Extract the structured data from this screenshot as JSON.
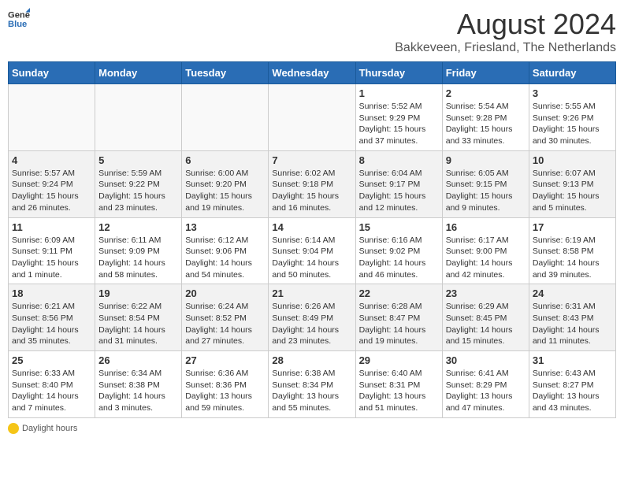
{
  "header": {
    "logo_general": "General",
    "logo_blue": "Blue",
    "title": "August 2024",
    "subtitle": "Bakkeveen, Friesland, The Netherlands"
  },
  "days_of_week": [
    "Sunday",
    "Monday",
    "Tuesday",
    "Wednesday",
    "Thursday",
    "Friday",
    "Saturday"
  ],
  "weeks": [
    [
      {
        "day": "",
        "info": ""
      },
      {
        "day": "",
        "info": ""
      },
      {
        "day": "",
        "info": ""
      },
      {
        "day": "",
        "info": ""
      },
      {
        "day": "1",
        "info": "Sunrise: 5:52 AM\nSunset: 9:29 PM\nDaylight: 15 hours\nand 37 minutes."
      },
      {
        "day": "2",
        "info": "Sunrise: 5:54 AM\nSunset: 9:28 PM\nDaylight: 15 hours\nand 33 minutes."
      },
      {
        "day": "3",
        "info": "Sunrise: 5:55 AM\nSunset: 9:26 PM\nDaylight: 15 hours\nand 30 minutes."
      }
    ],
    [
      {
        "day": "4",
        "info": "Sunrise: 5:57 AM\nSunset: 9:24 PM\nDaylight: 15 hours\nand 26 minutes."
      },
      {
        "day": "5",
        "info": "Sunrise: 5:59 AM\nSunset: 9:22 PM\nDaylight: 15 hours\nand 23 minutes."
      },
      {
        "day": "6",
        "info": "Sunrise: 6:00 AM\nSunset: 9:20 PM\nDaylight: 15 hours\nand 19 minutes."
      },
      {
        "day": "7",
        "info": "Sunrise: 6:02 AM\nSunset: 9:18 PM\nDaylight: 15 hours\nand 16 minutes."
      },
      {
        "day": "8",
        "info": "Sunrise: 6:04 AM\nSunset: 9:17 PM\nDaylight: 15 hours\nand 12 minutes."
      },
      {
        "day": "9",
        "info": "Sunrise: 6:05 AM\nSunset: 9:15 PM\nDaylight: 15 hours\nand 9 minutes."
      },
      {
        "day": "10",
        "info": "Sunrise: 6:07 AM\nSunset: 9:13 PM\nDaylight: 15 hours\nand 5 minutes."
      }
    ],
    [
      {
        "day": "11",
        "info": "Sunrise: 6:09 AM\nSunset: 9:11 PM\nDaylight: 15 hours\nand 1 minute."
      },
      {
        "day": "12",
        "info": "Sunrise: 6:11 AM\nSunset: 9:09 PM\nDaylight: 14 hours\nand 58 minutes."
      },
      {
        "day": "13",
        "info": "Sunrise: 6:12 AM\nSunset: 9:06 PM\nDaylight: 14 hours\nand 54 minutes."
      },
      {
        "day": "14",
        "info": "Sunrise: 6:14 AM\nSunset: 9:04 PM\nDaylight: 14 hours\nand 50 minutes."
      },
      {
        "day": "15",
        "info": "Sunrise: 6:16 AM\nSunset: 9:02 PM\nDaylight: 14 hours\nand 46 minutes."
      },
      {
        "day": "16",
        "info": "Sunrise: 6:17 AM\nSunset: 9:00 PM\nDaylight: 14 hours\nand 42 minutes."
      },
      {
        "day": "17",
        "info": "Sunrise: 6:19 AM\nSunset: 8:58 PM\nDaylight: 14 hours\nand 39 minutes."
      }
    ],
    [
      {
        "day": "18",
        "info": "Sunrise: 6:21 AM\nSunset: 8:56 PM\nDaylight: 14 hours\nand 35 minutes."
      },
      {
        "day": "19",
        "info": "Sunrise: 6:22 AM\nSunset: 8:54 PM\nDaylight: 14 hours\nand 31 minutes."
      },
      {
        "day": "20",
        "info": "Sunrise: 6:24 AM\nSunset: 8:52 PM\nDaylight: 14 hours\nand 27 minutes."
      },
      {
        "day": "21",
        "info": "Sunrise: 6:26 AM\nSunset: 8:49 PM\nDaylight: 14 hours\nand 23 minutes."
      },
      {
        "day": "22",
        "info": "Sunrise: 6:28 AM\nSunset: 8:47 PM\nDaylight: 14 hours\nand 19 minutes."
      },
      {
        "day": "23",
        "info": "Sunrise: 6:29 AM\nSunset: 8:45 PM\nDaylight: 14 hours\nand 15 minutes."
      },
      {
        "day": "24",
        "info": "Sunrise: 6:31 AM\nSunset: 8:43 PM\nDaylight: 14 hours\nand 11 minutes."
      }
    ],
    [
      {
        "day": "25",
        "info": "Sunrise: 6:33 AM\nSunset: 8:40 PM\nDaylight: 14 hours\nand 7 minutes."
      },
      {
        "day": "26",
        "info": "Sunrise: 6:34 AM\nSunset: 8:38 PM\nDaylight: 14 hours\nand 3 minutes."
      },
      {
        "day": "27",
        "info": "Sunrise: 6:36 AM\nSunset: 8:36 PM\nDaylight: 13 hours\nand 59 minutes."
      },
      {
        "day": "28",
        "info": "Sunrise: 6:38 AM\nSunset: 8:34 PM\nDaylight: 13 hours\nand 55 minutes."
      },
      {
        "day": "29",
        "info": "Sunrise: 6:40 AM\nSunset: 8:31 PM\nDaylight: 13 hours\nand 51 minutes."
      },
      {
        "day": "30",
        "info": "Sunrise: 6:41 AM\nSunset: 8:29 PM\nDaylight: 13 hours\nand 47 minutes."
      },
      {
        "day": "31",
        "info": "Sunrise: 6:43 AM\nSunset: 8:27 PM\nDaylight: 13 hours\nand 43 minutes."
      }
    ]
  ],
  "footer": {
    "daylight_label": "Daylight hours"
  },
  "colors": {
    "header_bg": "#2a6db5",
    "shaded_row": "#f2f2f2"
  }
}
